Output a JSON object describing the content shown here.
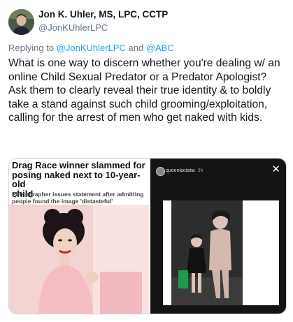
{
  "tweet": {
    "author_name": "Jon K. Uhler, MS, LPC, CCTP",
    "author_handle": "@JonKUhlerLPC",
    "reply_prefix": "Replying to",
    "reply_mention_1": "@JonKUhlerLPC",
    "reply_and": "and",
    "reply_mention_2": "@ABC",
    "text": "What is one way to discern whether you're dealing w/ an online Child Sexual Predator or a Predator Apologist? Ask them to clearly reveal their true identity & to boldly take a stand against such child grooming/exploitation, calling for the arrest of men who get naked with kids."
  },
  "media": {
    "left": {
      "headline": "Drag Race winner slammed for\nposing naked next to 10-year-old\nchild",
      "subheadline": "Photographer issues statement after admitting people found the image 'distasteful'"
    },
    "right": {
      "username": "queenlactatia",
      "time": "3h",
      "close_icon": "close-icon"
    }
  },
  "colors": {
    "link": "#1da1f2",
    "secondary_text": "#657786",
    "primary_text": "#14171a"
  }
}
